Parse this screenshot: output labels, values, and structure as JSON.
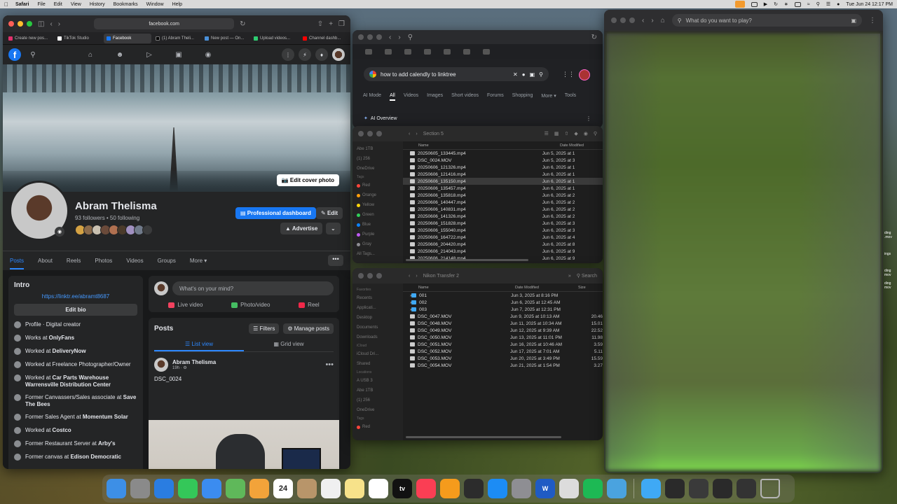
{
  "menubar": {
    "app": "Safari",
    "items": [
      "File",
      "Edit",
      "View",
      "History",
      "Bookmarks",
      "Window",
      "Help"
    ],
    "clock": "Tue Jun 24  12:17 PM"
  },
  "safari": {
    "url": "facebook.com",
    "tabs": [
      {
        "label": "Create new pos...",
        "color": "#e1306c"
      },
      {
        "label": "TikTok Studio",
        "color": "#ffffff"
      },
      {
        "label": "Facebook",
        "color": "#1877f2",
        "active": true
      },
      {
        "label": "(1) Abram Theli...",
        "color": "#000000"
      },
      {
        "label": "New post — On...",
        "color": "#4a90d9"
      },
      {
        "label": "Upload videos...",
        "color": "#2ecc71"
      },
      {
        "label": "Channel dashb...",
        "color": "#ff0000"
      }
    ]
  },
  "facebook": {
    "logo": "f",
    "edit_cover": "Edit cover photo",
    "name": "Abram Thelisma",
    "stats": "93 followers • 50 following",
    "professional_dashboard": "Professional dashboard",
    "edit": "Edit",
    "advertise": "Advertise",
    "tabs": [
      "Posts",
      "About",
      "Reels",
      "Photos",
      "Videos",
      "Groups",
      "More ▾"
    ],
    "more_dots": "•••",
    "intro": {
      "title": "Intro",
      "link": "https://linktr.ee/abramt8687",
      "edit_bio": "Edit bio",
      "rows": [
        {
          "pre": "Profile",
          "post": " · Digital creator",
          "bold": ""
        },
        {
          "pre": "Works at ",
          "bold": "OnlyFans",
          "post": ""
        },
        {
          "pre": "Worked at ",
          "bold": "DeliveryNow",
          "post": ""
        },
        {
          "pre": "Worked at Freelance Photographer/Owner",
          "bold": "",
          "post": ""
        },
        {
          "pre": "Worked at ",
          "bold": "Car Parts Warehouse Warrensville Distribution Center",
          "post": ""
        },
        {
          "pre": "Former Canvassers/Sales associate at ",
          "bold": "Save The Bees",
          "post": ""
        },
        {
          "pre": "Former Sales Agent at ",
          "bold": "Momentum Solar",
          "post": ""
        },
        {
          "pre": "Worked at ",
          "bold": "Costco",
          "post": ""
        },
        {
          "pre": "Former Restaurant Server at ",
          "bold": "Arby's",
          "post": ""
        },
        {
          "pre": "Former canvas at ",
          "bold": "Edison Democratic",
          "post": ""
        }
      ]
    },
    "composer": {
      "placeholder": "What's on your mind?",
      "live": "Live video",
      "photo": "Photo/video",
      "reel": "Reel"
    },
    "posts": {
      "title": "Posts",
      "filters": "Filters",
      "manage": "Manage posts",
      "list_view": "List view",
      "grid_view": "Grid view",
      "author": "Abram Thelisma",
      "time": "19h · ⚙",
      "caption": "DSC_0024"
    }
  },
  "chrome": {
    "query": "how to add calendly to linktree",
    "filters": [
      "AI Mode",
      "All",
      "Videos",
      "Images",
      "Short videos",
      "Forums",
      "Shopping",
      "More ▾",
      "Tools"
    ],
    "ai_overview": "AI Overview"
  },
  "finder1": {
    "title": "Section 5",
    "col_name": "Name",
    "col_date": "Date Modified",
    "sidebar": [
      "Abe 1TB",
      "(1) 256",
      "OneDrive",
      "Tags",
      "Red",
      "Orange",
      "Yellow",
      "Green",
      "Blue",
      "Purple",
      "Gray",
      "All Tags..."
    ],
    "tag_colors": [
      "#ff453a",
      "#ff9f0a",
      "#ffd60a",
      "#30d158",
      "#0a84ff",
      "#bf5af2",
      "#8e8e93"
    ],
    "files": [
      {
        "name": "20250605_133445.mp4",
        "date": "Jun 5, 2025 at 1"
      },
      {
        "name": "DSC_0024.MOV",
        "date": "Jun 5, 2025 at 3"
      },
      {
        "name": "20250606_121326.mp4",
        "date": "Jun 6, 2025 at 1"
      },
      {
        "name": "20250606_121416.mp4",
        "date": "Jun 6, 2025 at 1"
      },
      {
        "name": "20250606_135150.mp4",
        "date": "Jun 6, 2025 at 1",
        "selected": true
      },
      {
        "name": "20250606_135457.mp4",
        "date": "Jun 6, 2025 at 1"
      },
      {
        "name": "20250606_135818.mp4",
        "date": "Jun 6, 2025 at 2"
      },
      {
        "name": "20250606_140447.mp4",
        "date": "Jun 6, 2025 at 2"
      },
      {
        "name": "20250606_140831.mp4",
        "date": "Jun 6, 2025 at 2"
      },
      {
        "name": "20250606_141326.mp4",
        "date": "Jun 6, 2025 at 2"
      },
      {
        "name": "20250606_151828.mp4",
        "date": "Jun 6, 2025 at 3"
      },
      {
        "name": "20250606_155040.mp4",
        "date": "Jun 6, 2025 at 3"
      },
      {
        "name": "20250606_164722.mp4",
        "date": "Jun 6, 2025 at 4"
      },
      {
        "name": "20250606_204420.mp4",
        "date": "Jun 6, 2025 at 8"
      },
      {
        "name": "20250606_214043.mp4",
        "date": "Jun 6, 2025 at 9"
      },
      {
        "name": "20250606_214148.mp4",
        "date": "Jun 6, 2025 at 9"
      }
    ]
  },
  "finder2": {
    "title": "Nikon Transfer 2",
    "search": "Search",
    "col_name": "Name",
    "col_date": "Date Modified",
    "col_size": "Size",
    "sidebar": [
      "Favorites",
      "Recents",
      "Applicati...",
      "Desktop",
      "Documents",
      "Downloads",
      "iCloud",
      "iCloud Dri...",
      "Shared",
      "Locations",
      "A USB 3",
      "Abe 1TB",
      "(1) 256",
      "OneDrive",
      "Tags",
      "Red"
    ],
    "files": [
      {
        "name": "001",
        "date": "Jun 3, 2025 at 8:16 PM",
        "size": "",
        "folder": true
      },
      {
        "name": "002",
        "date": "Jun 6, 2025 at 12:45 AM",
        "size": "",
        "folder": true
      },
      {
        "name": "003",
        "date": "Jun 7, 2025 at 12:31 PM",
        "size": "",
        "folder": true
      },
      {
        "name": "DSC_0047.MOV",
        "date": "Jun 9, 2025 at 10:13 AM",
        "size": "20.46"
      },
      {
        "name": "DSC_0048.MOV",
        "date": "Jun 11, 2025 at 10:34 AM",
        "size": "15.01"
      },
      {
        "name": "DSC_0049.MOV",
        "date": "Jun 12, 2025 at 9:39 AM",
        "size": "22.52"
      },
      {
        "name": "DSC_0050.MOV",
        "date": "Jun 13, 2025 at 11:01 PM",
        "size": "11.98"
      },
      {
        "name": "DSC_0051.MOV",
        "date": "Jun 16, 2025 at 10:46 AM",
        "size": "3.59"
      },
      {
        "name": "DSC_0052.MOV",
        "date": "Jun 17, 2025 at 7:01 AM",
        "size": "5.11"
      },
      {
        "name": "DSC_0053.MOV",
        "date": "Jun 20, 2025 at 3:49 PM",
        "size": "15.59"
      },
      {
        "name": "DSC_0054.MOV",
        "date": "Jun 21, 2025 at 1:54 PM",
        "size": "3.27"
      }
    ]
  },
  "right_browser": {
    "search_placeholder": "What do you want to play?"
  },
  "edge_labels": [
    "ding",
    ".mov",
    "",
    "",
    "",
    "ings",
    "",
    "",
    "",
    "ding",
    "mov",
    "",
    "ding",
    "mov"
  ],
  "dock": [
    {
      "name": "finder",
      "color": "#3d8fe6",
      "label": ""
    },
    {
      "name": "launchpad",
      "color": "#8a8a8a",
      "label": ""
    },
    {
      "name": "safari",
      "color": "#2a7de1",
      "label": ""
    },
    {
      "name": "messages",
      "color": "#34c759",
      "label": ""
    },
    {
      "name": "mail",
      "color": "#3b8cf0",
      "label": ""
    },
    {
      "name": "maps",
      "color": "#5fb85a",
      "label": ""
    },
    {
      "name": "photos",
      "color": "#f2a33a",
      "label": ""
    },
    {
      "name": "calendar",
      "color": "#ffffff",
      "label": "24"
    },
    {
      "name": "contacts",
      "color": "#b8956a",
      "label": ""
    },
    {
      "name": "reminders",
      "color": "#f0f0f0",
      "label": ""
    },
    {
      "name": "notes",
      "color": "#f7e28a",
      "label": ""
    },
    {
      "name": "freeform",
      "color": "#ffffff",
      "label": ""
    },
    {
      "name": "tv",
      "color": "#111111",
      "label": "tv"
    },
    {
      "name": "music",
      "color": "#fa3e54",
      "label": ""
    },
    {
      "name": "pages",
      "color": "#f59b1c",
      "label": ""
    },
    {
      "name": "quicktime",
      "color": "#2c2c2c",
      "label": ""
    },
    {
      "name": "app-store",
      "color": "#1c8cf5",
      "label": ""
    },
    {
      "name": "system-settings",
      "color": "#8e8e93",
      "label": ""
    },
    {
      "name": "word",
      "color": "#1f5bc4",
      "label": "W"
    },
    {
      "name": "preview",
      "color": "#dcdcdc",
      "label": ""
    },
    {
      "name": "spotify",
      "color": "#1db954",
      "label": ""
    },
    {
      "name": "app-other",
      "color": "#4aa3df",
      "label": ""
    },
    {
      "name": "downloads-folder",
      "color": "#3fa9f5",
      "label": ""
    },
    {
      "name": "stack-1",
      "color": "#2a2a2a",
      "label": ""
    },
    {
      "name": "stack-2",
      "color": "#3a3a3a",
      "label": ""
    },
    {
      "name": "stack-3",
      "color": "#2a2a2a",
      "label": ""
    },
    {
      "name": "stack-4",
      "color": "#333333",
      "label": ""
    },
    {
      "name": "trash",
      "color": "#b5b5b5",
      "label": ""
    }
  ]
}
